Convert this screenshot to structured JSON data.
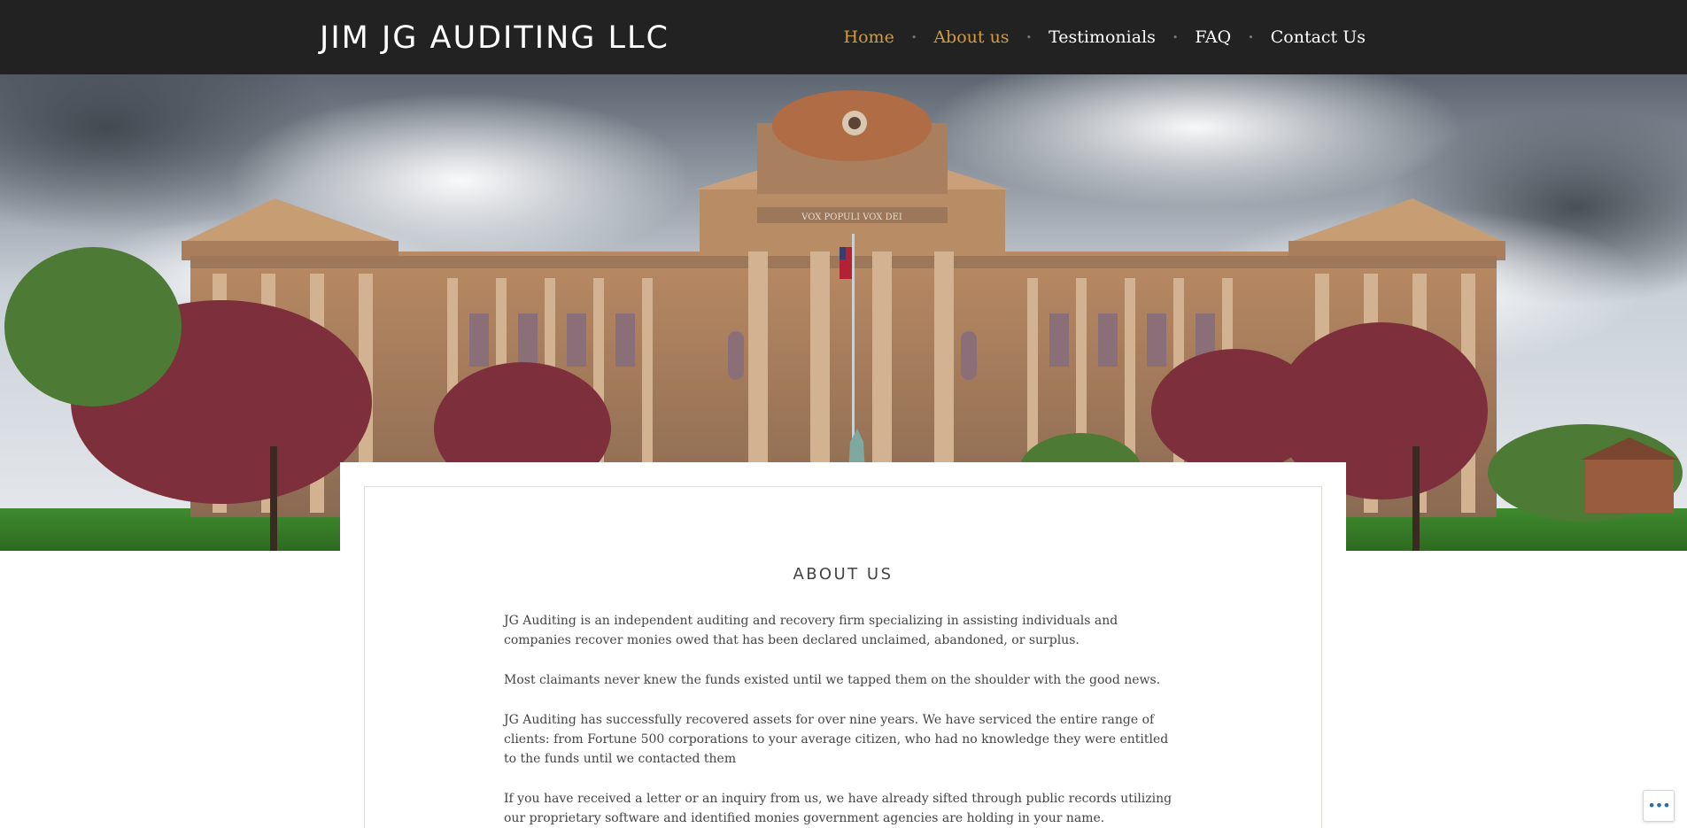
{
  "site": {
    "title": "JIM JG AUDITING LLC"
  },
  "nav": {
    "items": [
      {
        "label": "Home",
        "active": true
      },
      {
        "label": "About us",
        "active": true
      },
      {
        "label": "Testimonials",
        "active": false
      },
      {
        "label": "FAQ",
        "active": false
      },
      {
        "label": "Contact Us",
        "active": false
      }
    ],
    "separator": "•"
  },
  "hero": {
    "image_name": "courthouse-hero-image",
    "inscription": "VOX POPULI VOX DEI"
  },
  "page": {
    "heading": "ABOUT US",
    "paragraphs": [
      "JG Auditing is an independent auditing and recovery firm specializing in assisting individuals and companies recover monies owed that has been declared unclaimed, abandoned, or surplus.",
      "Most claimants never knew the funds existed until we tapped them on the shoulder with the good news.",
      "JG Auditing has successfully recovered assets for over nine years. We have serviced the entire range of clients: from Fortune 500 corporations to your average citizen, who had no knowledge they were entitled to the funds until we contacted them",
      "If you have received a letter or an inquiry from us, we have already sifted through public records utilizing our proprietary software and identified monies government agencies are holding in your name."
    ]
  },
  "widget": {
    "icon": "more-dots-icon",
    "glyph": "•••"
  },
  "colors": {
    "header_bg": "#222222",
    "accent": "#d29c3e",
    "text": "#444444"
  }
}
